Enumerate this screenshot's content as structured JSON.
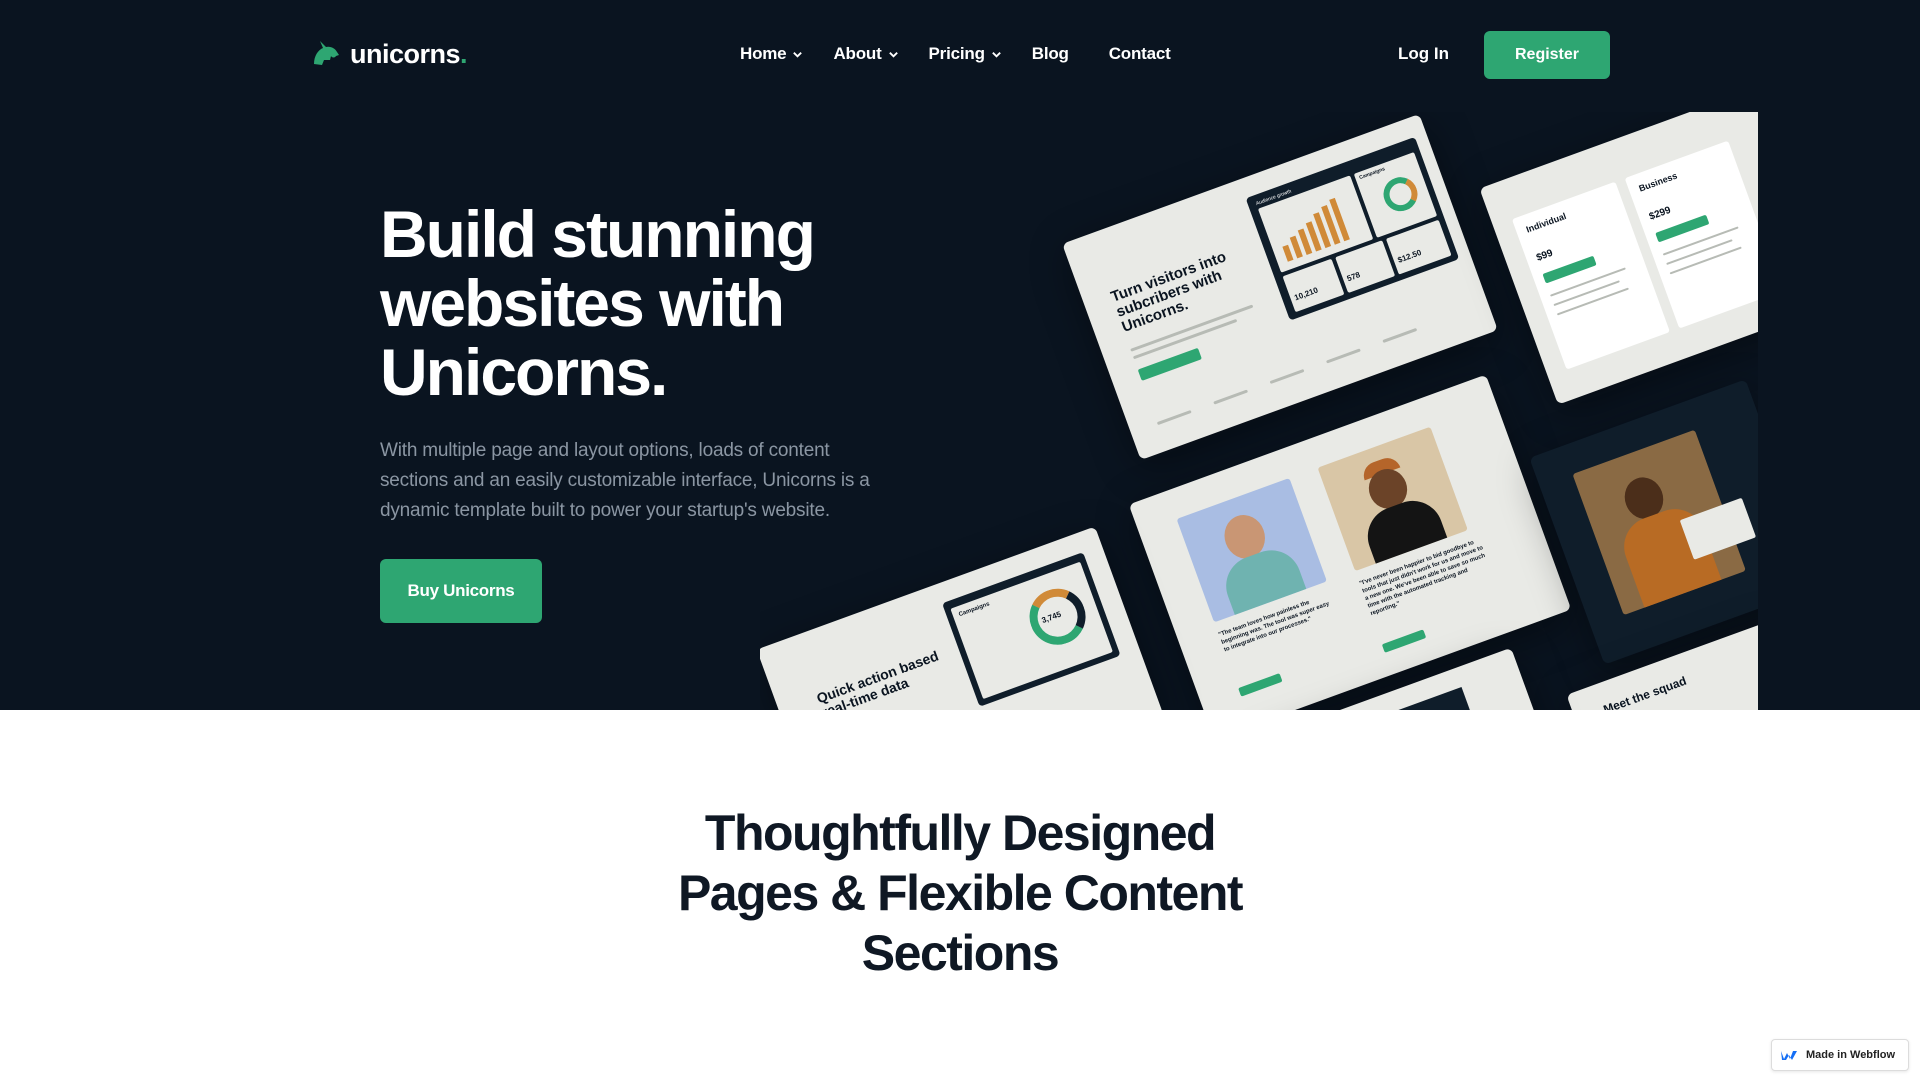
{
  "brand": {
    "name": "unicorns",
    "dot": ".",
    "accent_color": "#2ea672",
    "hero_bg_color": "#0a1420"
  },
  "nav": {
    "items": [
      {
        "label": "Home",
        "has_dropdown": true
      },
      {
        "label": "About",
        "has_dropdown": true
      },
      {
        "label": "Pricing",
        "has_dropdown": true
      },
      {
        "label": "Blog",
        "has_dropdown": false
      },
      {
        "label": "Contact",
        "has_dropdown": false
      }
    ],
    "login_label": "Log In",
    "register_label": "Register"
  },
  "hero": {
    "headline_line1": "Build stunning",
    "headline_line2": "websites with",
    "headline_line3": "Unicorns.",
    "subtext": "With multiple page and layout options, loads of content sections and an easily customizable interface, Unicorns is a dynamic template built to power your startup's website.",
    "cta_label": "Buy Unicorns"
  },
  "mockups": {
    "card1_title": "Turn visitors into subcribers with Unicorns.",
    "card1_stat1": "10,210",
    "card1_stat2": "578",
    "card1_stat3": "$12.50",
    "card1_panel_label": "Audience growth",
    "card1_campaigns": "Campaigns",
    "card2_plan1": "Individual",
    "card2_price1": "$99",
    "card2_plan2": "Business",
    "card2_price2": "$299",
    "card3_quote1": "\"The team loves how painless the beginning was. The tool was super easy to integrate into our processes.\"",
    "card3_quote2": "\"I've never been happier to bid goodbye to tools that just didn't work for us and move to a new one. We've been able to save so much time with the automated tracking and reporting.\"",
    "card4_title": "Quick action based real-time data",
    "card4_campaigns": "Campaigns",
    "card4_value": "3,745",
    "card6_title": "Meet the squad"
  },
  "section2": {
    "line1": "Thoughtfully Designed",
    "line2": "Pages & Flexible Content",
    "line3": "Sections"
  },
  "badge": {
    "label": "Made in Webflow",
    "icon": "webflow-icon"
  }
}
